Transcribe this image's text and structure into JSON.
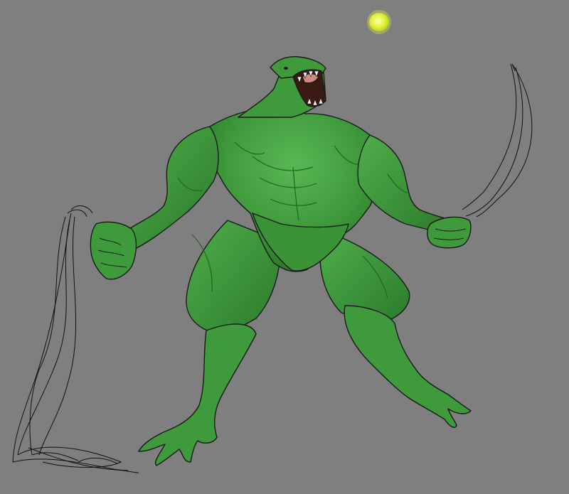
{
  "artwork": {
    "subject": "lizard-warrior-illustration",
    "colors": {
      "background": "#7f7f7f",
      "skin": "#3f9a3c",
      "skin_dark": "#2c7a2b",
      "skin_shadow": "#1f5f20",
      "skin_light": "#59b754",
      "outline": "#1a1a1a",
      "mouth": "#3a1b14",
      "tongue": "#d08a7e",
      "teeth": "#f2efe6",
      "glow_orb": "#e6f23a",
      "sketch_line": "#111111"
    }
  }
}
